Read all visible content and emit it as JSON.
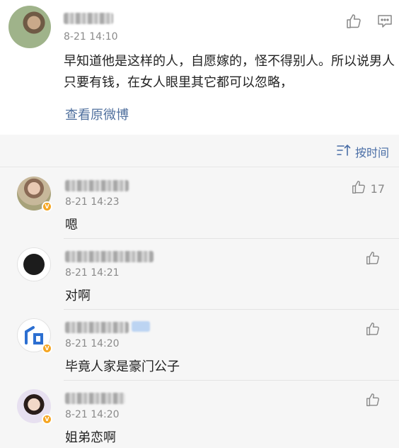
{
  "post": {
    "time": "8-21 14:10",
    "text": "早知道他是这样的人，自愿嫁的，怪不得别人。所以说男人只要有钱，在女人眼里其它都可以忽略，",
    "view_original": "查看原微博"
  },
  "sort": {
    "label": "按时间"
  },
  "comments": [
    {
      "time": "8-21 14:23",
      "text": "嗯",
      "likes": "17"
    },
    {
      "time": "8-21 14:21",
      "text": "对啊",
      "likes": ""
    },
    {
      "time": "8-21 14:20",
      "text": "毕竟人家是豪门公子",
      "likes": ""
    },
    {
      "time": "8-21 14:20",
      "text": "姐弟恋啊",
      "likes": ""
    }
  ],
  "colors": {
    "link": "#50709e",
    "sort": "#4a6ea6",
    "verified": "#f5a623",
    "background": "#f6f6f6"
  },
  "icons": [
    "thumbs-up-icon",
    "comment-icon",
    "sort-icon",
    "verified-badge-icon"
  ]
}
